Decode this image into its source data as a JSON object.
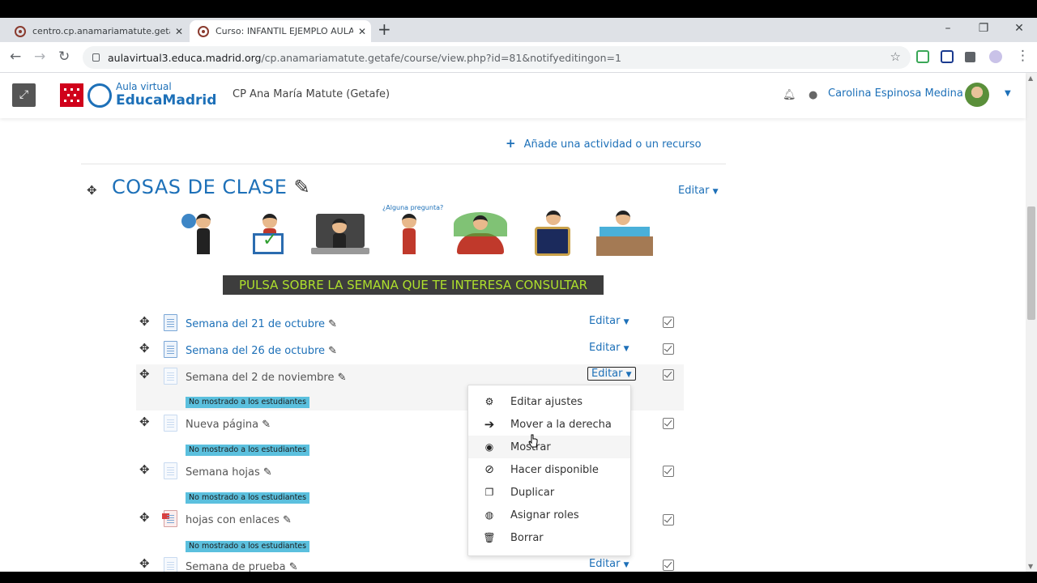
{
  "browser": {
    "tabs": [
      {
        "title": "centro.cp.anamariamatute.getafe",
        "active": false
      },
      {
        "title": "Curso: INFANTIL EJEMPLO AULA",
        "active": true
      }
    ],
    "new_tab": "+",
    "url_host": "aulavirtual3.educa.madrid.org",
    "url_path": "/cp.anamariamatute.getafe/course/view.php?id=81&notifyeditingon=1"
  },
  "header": {
    "logo_small": "Aula virtual",
    "logo_big": "EducaMadrid",
    "site_name": "CP Ana María Matute (Getafe)",
    "user_name": "Carolina Espinosa Medina"
  },
  "course": {
    "add_activity": "Añade una actividad o un recurso",
    "section_title": "COSAS DE CLASE",
    "section_edit": "Editar",
    "banner": "PULSA SOBRE LA SEMANA QUE TE INTERESA CONSULTAR",
    "pic_caption": "¿Alguna pregunta?",
    "hidden_badge": "No mostrado a los estudiantes",
    "edit_label": "Editar",
    "items": [
      {
        "label": "Semana del 21 de octubre"
      },
      {
        "label": "Semana del 26 de octubre"
      },
      {
        "label": "Semana del 2 de noviembre"
      },
      {
        "label": "Nueva página"
      },
      {
        "label": "Semana hojas"
      },
      {
        "label": "hojas con enlaces"
      },
      {
        "label": "Semana de prueba"
      }
    ]
  },
  "menu": {
    "items": [
      {
        "label": "Editar ajustes",
        "icon": "gear-icon"
      },
      {
        "label": "Mover a la derecha",
        "icon": "arrow-right-icon"
      },
      {
        "label": "Mostrar",
        "icon": "eye-slash-icon"
      },
      {
        "label": "Hacer disponible",
        "icon": "ban-icon"
      },
      {
        "label": "Duplicar",
        "icon": "copy-icon"
      },
      {
        "label": "Asignar roles",
        "icon": "user-circle-icon"
      },
      {
        "label": "Borrar",
        "icon": "trash-icon"
      }
    ]
  },
  "colors": {
    "link": "#1d70b8",
    "banner_bg": "#3d3d3d",
    "banner_text": "#aee02c",
    "badge": "#5bc0de",
    "brand_red": "#d0011b"
  }
}
